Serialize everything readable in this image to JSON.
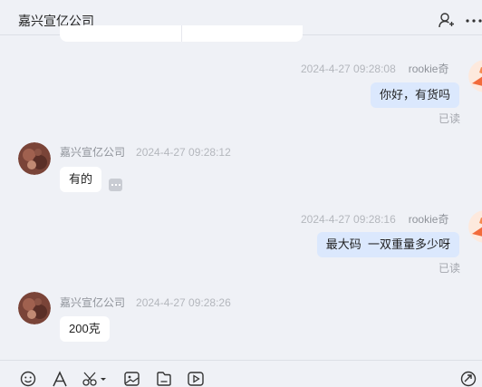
{
  "header": {
    "title": "嘉兴宣亿公司"
  },
  "messages": [
    {
      "direction": "outgoing",
      "time": "2024-4-27 09:28:08",
      "sender": "rookie奇",
      "text": "你好，有货吗",
      "status": "已读"
    },
    {
      "direction": "incoming",
      "sender": "嘉兴宣亿公司",
      "time": "2024-4-27 09:28:12",
      "text": "有的"
    },
    {
      "direction": "outgoing",
      "time": "2024-4-27 09:28:16",
      "sender": "rookie奇",
      "text": "最大码  一双重量多少呀",
      "status": "已读"
    },
    {
      "direction": "incoming",
      "sender": "嘉兴宣亿公司",
      "time": "2024-4-27 09:28:26",
      "text": "200克"
    }
  ],
  "toolbar": {
    "icons": [
      "emoji-icon",
      "font-icon",
      "scissors-icon",
      "image-icon",
      "file-icon",
      "video-icon",
      "send-icon"
    ]
  },
  "colors": {
    "background": "#eff1f6",
    "outgoing_bubble": "#dbe8fd",
    "incoming_bubble": "#ffffff",
    "avatar_right": "#f26b3a"
  }
}
